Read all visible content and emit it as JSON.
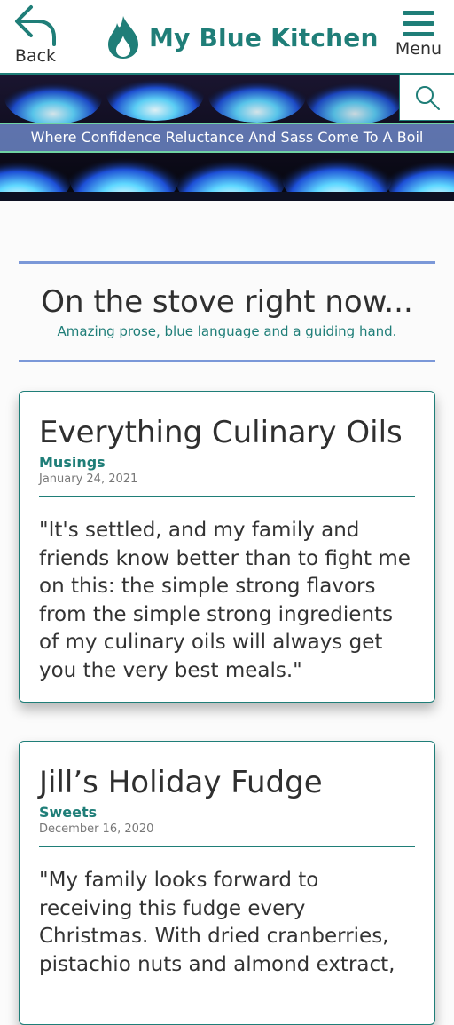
{
  "header": {
    "back_label": "Back",
    "site_title": "My Blue Kitchen",
    "menu_label": "Menu"
  },
  "hero": {
    "tagline": "Where Confidence Reluctance And Sass Come To A Boil"
  },
  "section": {
    "title": "On the stove right now...",
    "subtitle": "Amazing prose, blue language and a guiding hand."
  },
  "posts": [
    {
      "title": "Everything Culinary Oils",
      "category": "Musings",
      "date": "January 24, 2021",
      "excerpt": "\"It's settled, and my family and friends know better than to fight me on this: the simple strong flavors from the simple strong ingredients of my culinary oils will always get you the very best meals.\""
    },
    {
      "title": "Jill’s Holiday Fudge",
      "category": "Sweets",
      "date": "December 16, 2020",
      "excerpt": "\"My family looks forward to receiving this fudge every Christmas.  With dried cranberries, pistachio nuts and almond extract,"
    }
  ],
  "colors": {
    "brand_teal": "#1f7e78",
    "rule_blue": "#7b98d8"
  },
  "icons": {
    "back": "back-arrow-icon",
    "logo": "flame-icon",
    "menu": "hamburger-menu-icon",
    "search": "search-icon"
  }
}
